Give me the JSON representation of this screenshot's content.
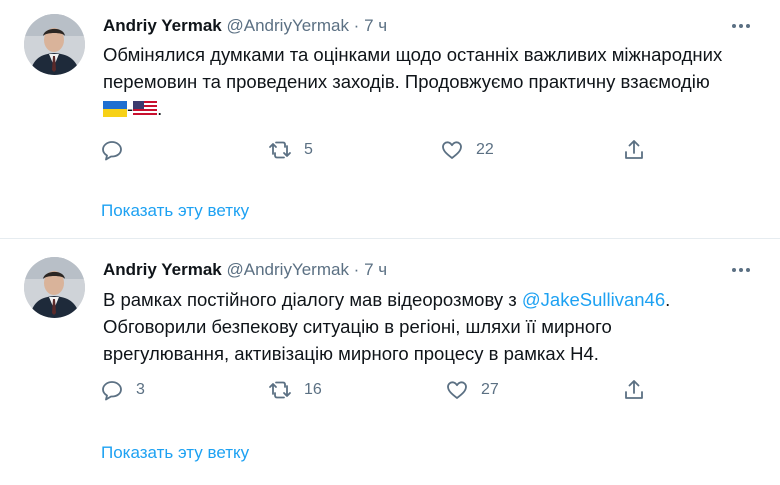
{
  "tweets": [
    {
      "author_name": "Andriy Yermak",
      "handle": "@AndriyYermak",
      "separator": " · ",
      "time": "7 ч",
      "text_line1": "Обмінялися думками та оцінками щодо останніх важливих міжнародних",
      "text_line2": "перемовин та проведених заходів. Продовжуємо практичну взаємодію",
      "text_line3_suffix": ".",
      "flag_dash": "-",
      "reply_count": "",
      "retweet_count": "5",
      "like_count": "22",
      "show_thread": "Показать эту ветку"
    },
    {
      "author_name": "Andriy Yermak",
      "handle": "@AndriyYermak",
      "separator": " · ",
      "time": "7 ч",
      "text_line1_prefix": "В рамках постійного діалогу мав відеорозмову з ",
      "mention": "@JakeSullivan46",
      "text_line1_suffix": ".",
      "text_line2": "Обговорили безпекову ситуацію в регіоні, шляхи її мирного",
      "text_line3": "врегулювання, активізацію мирного процесу в рамках Н4.",
      "reply_count": "3",
      "retweet_count": "16",
      "like_count": "27",
      "show_thread": "Показать эту ветку"
    }
  ],
  "icons": [
    "avatar-photo",
    "more-icon",
    "reply-icon",
    "retweet-icon",
    "like-icon",
    "share-icon",
    "ukraine-flag-icon",
    "usa-flag-icon"
  ],
  "colors": {
    "link": "#1da1f2",
    "secondary": "#5b7083",
    "divider": "#e6ecf0"
  }
}
